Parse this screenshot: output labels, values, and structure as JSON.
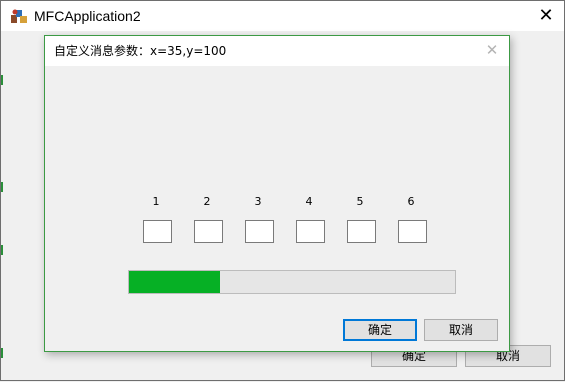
{
  "main_window": {
    "title": "MFCApplication2",
    "close_glyph": "✕",
    "ok_label": "确定",
    "cancel_label": "取消"
  },
  "dialog": {
    "title": "自定义消息参数：x=35,y=100",
    "close_glyph": "✕",
    "number_labels": [
      "1",
      "2",
      "3",
      "4",
      "5",
      "6"
    ],
    "number_boxes": [
      "",
      "",
      "",
      "",
      "",
      ""
    ],
    "progress_fraction": 0.28,
    "progress_color": "#06b025",
    "ok_label": "确定",
    "cancel_label": "取消"
  },
  "icons": {
    "app_icon": "mfc-app-icon",
    "close_icon": "close-icon"
  }
}
